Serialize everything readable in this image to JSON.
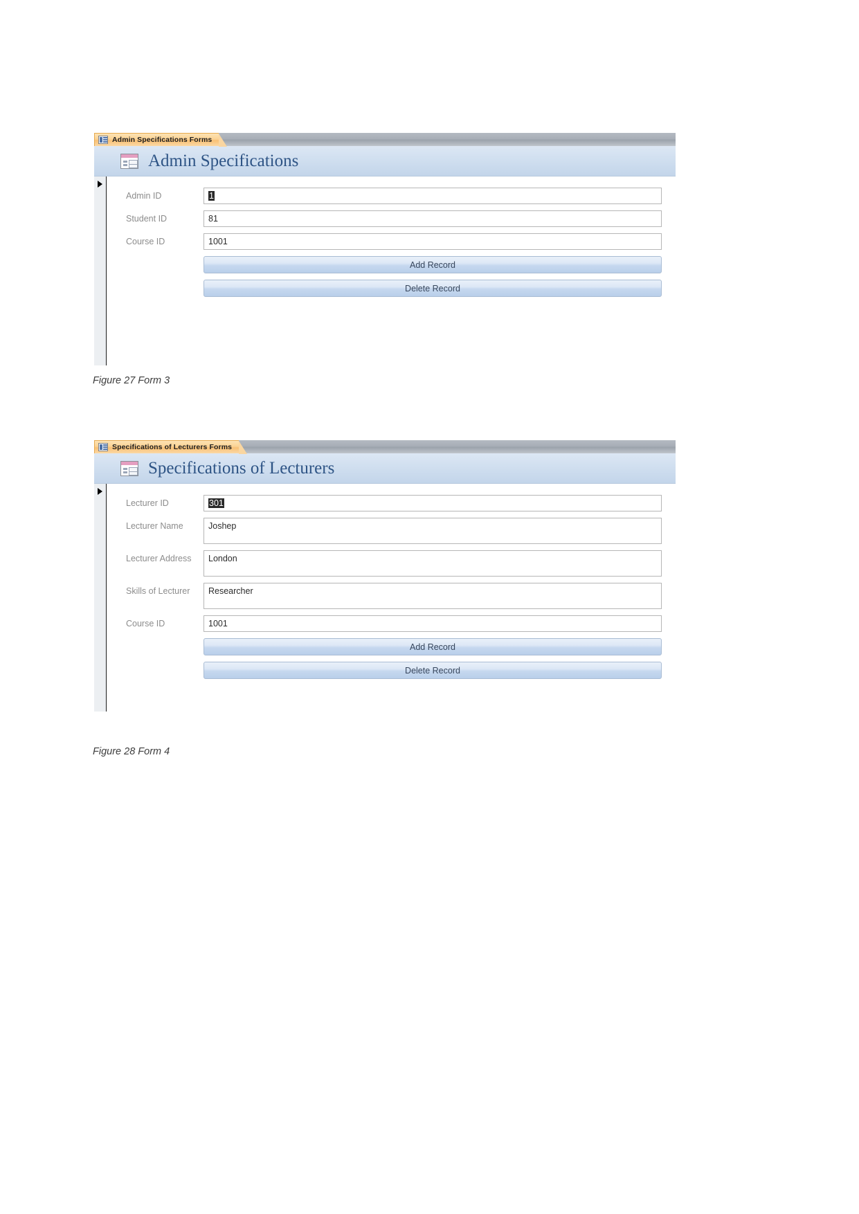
{
  "document": {
    "page_background": "#ffffff"
  },
  "figures": [
    {
      "id": "form3",
      "tab": {
        "label": "Admin Specifications Forms",
        "icon": "form-datasheet-icon"
      },
      "header": {
        "title": "Admin Specifications",
        "icon": "form-design-icon"
      },
      "fields": [
        {
          "label": "Admin ID",
          "value": "1",
          "selected": true,
          "tall": false
        },
        {
          "label": "Student ID",
          "value": "81",
          "selected": false,
          "tall": false
        },
        {
          "label": "Course ID",
          "value": "1001",
          "selected": false,
          "tall": false
        }
      ],
      "buttons": [
        {
          "label": "Add Record"
        },
        {
          "label": "Delete Record"
        }
      ],
      "caption": "Figure 27 Form 3"
    },
    {
      "id": "form4",
      "tab": {
        "label": "Specifications of Lecturers Forms",
        "icon": "form-datasheet-icon"
      },
      "header": {
        "title": "Specifications of Lecturers",
        "icon": "form-design-icon"
      },
      "fields": [
        {
          "label": "Lecturer ID",
          "value": "301",
          "selected": true,
          "tall": false
        },
        {
          "label": "Lecturer Name",
          "value": "Joshep",
          "selected": false,
          "tall": true
        },
        {
          "label": "Lecturer Address",
          "value": "London",
          "selected": false,
          "tall": true
        },
        {
          "label": "Skills of Lecturer",
          "value": "Researcher",
          "selected": false,
          "tall": true
        },
        {
          "label": "Course ID",
          "value": "1001",
          "selected": false,
          "tall": false
        }
      ],
      "buttons": [
        {
          "label": "Add Record"
        },
        {
          "label": "Delete Record"
        }
      ],
      "caption": "Figure 28 Form 4"
    }
  ],
  "colors": {
    "tab_orange": "#f8c075",
    "header_blue": "#cfdeef",
    "title_blue": "#2e5485",
    "button_blue": "#b9cfea",
    "label_gray": "#8c8c8c"
  }
}
